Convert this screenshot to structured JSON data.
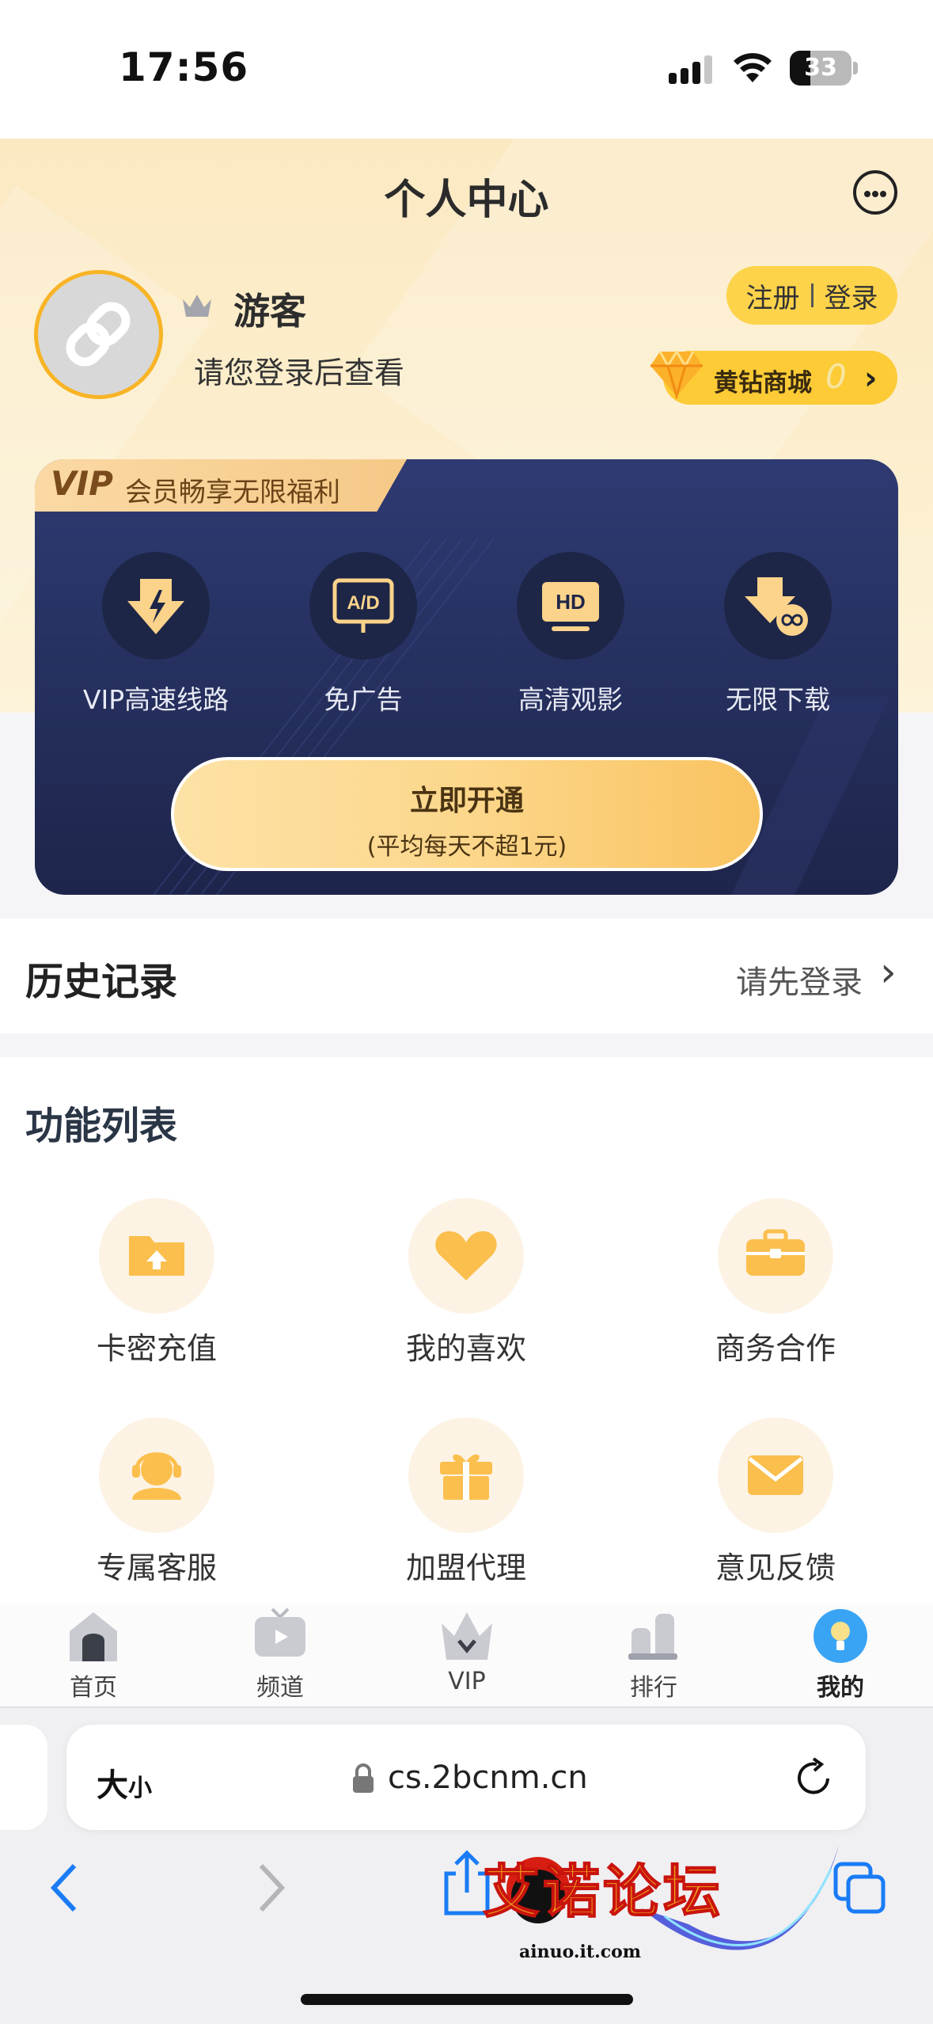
{
  "status_bar": {
    "time": "17:56",
    "battery": "33",
    "battery_level": 0.33
  },
  "header": {
    "title": "个人中心"
  },
  "profile": {
    "username": "游客",
    "hint": "请您登录后查看",
    "register_label": "注册",
    "login_label": "登录",
    "diamond_mall_label": "黄钻商城",
    "diamond_count": "0"
  },
  "vip": {
    "banner_logo": "VIP",
    "banner_text": "会员畅享无限福利",
    "benefits": [
      {
        "label": "VIP高速线路",
        "icon": "lightning-download-icon"
      },
      {
        "label": "免广告",
        "icon": "no-ads-icon"
      },
      {
        "label": "高清观影",
        "icon": "hd-icon"
      },
      {
        "label": "无限下载",
        "icon": "unlimited-download-icon"
      }
    ],
    "cta_title": "立即开通",
    "cta_subtitle": "(平均每天不超1元)"
  },
  "history": {
    "title": "历史记录",
    "link": "请先登录"
  },
  "functions": {
    "title": "功能列表",
    "items": [
      {
        "label": "卡密充值",
        "icon": "folder-upload-icon"
      },
      {
        "label": "我的喜欢",
        "icon": "heart-icon"
      },
      {
        "label": "商务合作",
        "icon": "briefcase-icon"
      },
      {
        "label": "专属客服",
        "icon": "headset-icon"
      },
      {
        "label": "加盟代理",
        "icon": "gift-icon"
      },
      {
        "label": "意见反馈",
        "icon": "mail-icon"
      }
    ]
  },
  "tab_bar": {
    "items": [
      {
        "label": "首页",
        "icon": "home-icon"
      },
      {
        "label": "频道",
        "icon": "tv-icon"
      },
      {
        "label": "VIP",
        "icon": "crown-icon"
      },
      {
        "label": "排行",
        "icon": "rank-icon"
      },
      {
        "label": "我的",
        "icon": "profile-bulb-icon",
        "active": true
      }
    ]
  },
  "browser": {
    "text_size_label_big": "大",
    "text_size_label_small": "小",
    "url": "cs.2bcnm.cn"
  },
  "watermark": {
    "text": "艾诺论坛",
    "url": "ainuo.it.com"
  },
  "colors": {
    "accent": "#fcd34a",
    "vip_card": "#2e3a72",
    "cta": "#fcd78c"
  }
}
